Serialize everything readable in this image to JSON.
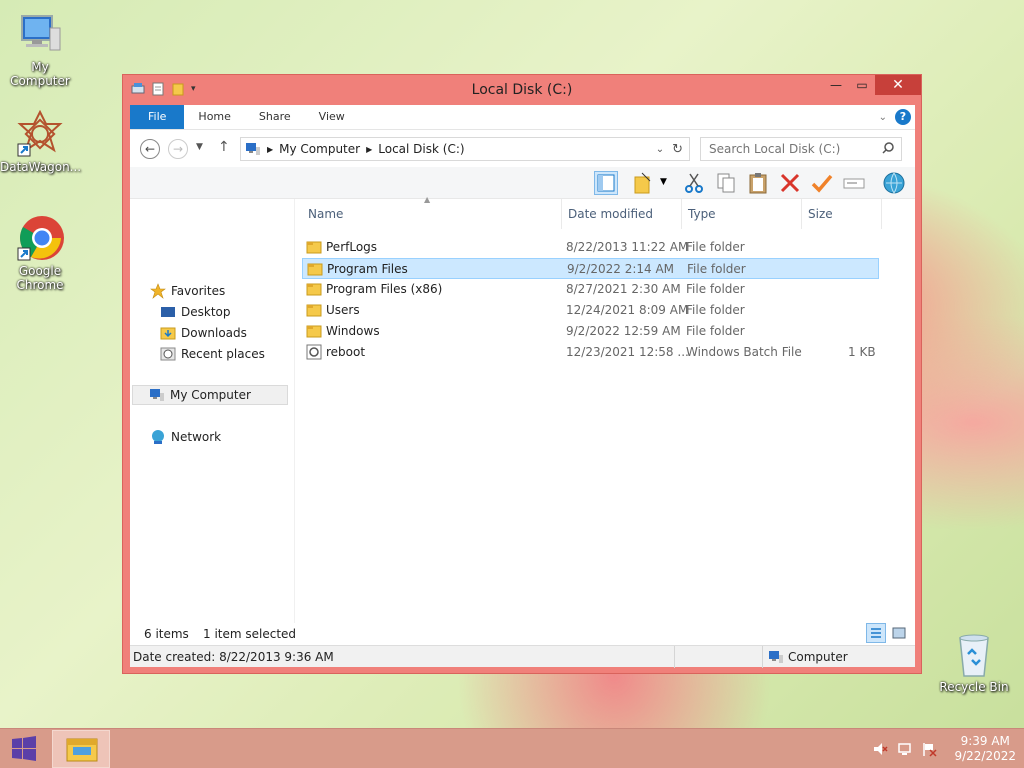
{
  "desktop": {
    "icons": [
      {
        "label": "My Computer"
      },
      {
        "label": "DataWagon..."
      },
      {
        "label": "Google Chrome"
      },
      {
        "label": "Recycle Bin"
      }
    ]
  },
  "window": {
    "title": "Local Disk (C:)",
    "tabs": [
      "File",
      "Home",
      "Share",
      "View"
    ],
    "address": [
      "My Computer",
      "Local Disk (C:)"
    ],
    "search_placeholder": "Search Local Disk (C:)",
    "nav": {
      "favorites": "Favorites",
      "desktop": "Desktop",
      "downloads": "Downloads",
      "recent": "Recent places",
      "computer": "My Computer",
      "network": "Network"
    },
    "columns": [
      "Name",
      "Date modified",
      "Type",
      "Size"
    ],
    "files": [
      {
        "name": "PerfLogs",
        "date": "8/22/2013 11:22 AM",
        "type": "File folder",
        "size": "",
        "kind": "folder"
      },
      {
        "name": "Program Files",
        "date": "9/2/2022 2:14 AM",
        "type": "File folder",
        "size": "",
        "kind": "folder"
      },
      {
        "name": "Program Files (x86)",
        "date": "8/27/2021 2:30 AM",
        "type": "File folder",
        "size": "",
        "kind": "folder"
      },
      {
        "name": "Users",
        "date": "12/24/2021 8:09 AM",
        "type": "File folder",
        "size": "",
        "kind": "folder"
      },
      {
        "name": "Windows",
        "date": "9/2/2022 12:59 AM",
        "type": "File folder",
        "size": "",
        "kind": "folder"
      },
      {
        "name": "reboot",
        "date": "12/23/2021 12:58 ...",
        "type": "Windows Batch File",
        "size": "1 KB",
        "kind": "batch"
      }
    ],
    "status": {
      "items": "6 items",
      "selected": "1 item selected",
      "date_created": "Date created: 8/22/2013 9:36 AM",
      "location": "Computer"
    }
  },
  "taskbar": {
    "time": "9:39 AM",
    "date": "9/22/2022"
  },
  "colors": {
    "accent": "#1979ca",
    "window_frame": "#f0807a",
    "selection": "#cce8ff",
    "taskbar": "#d89b8a"
  }
}
